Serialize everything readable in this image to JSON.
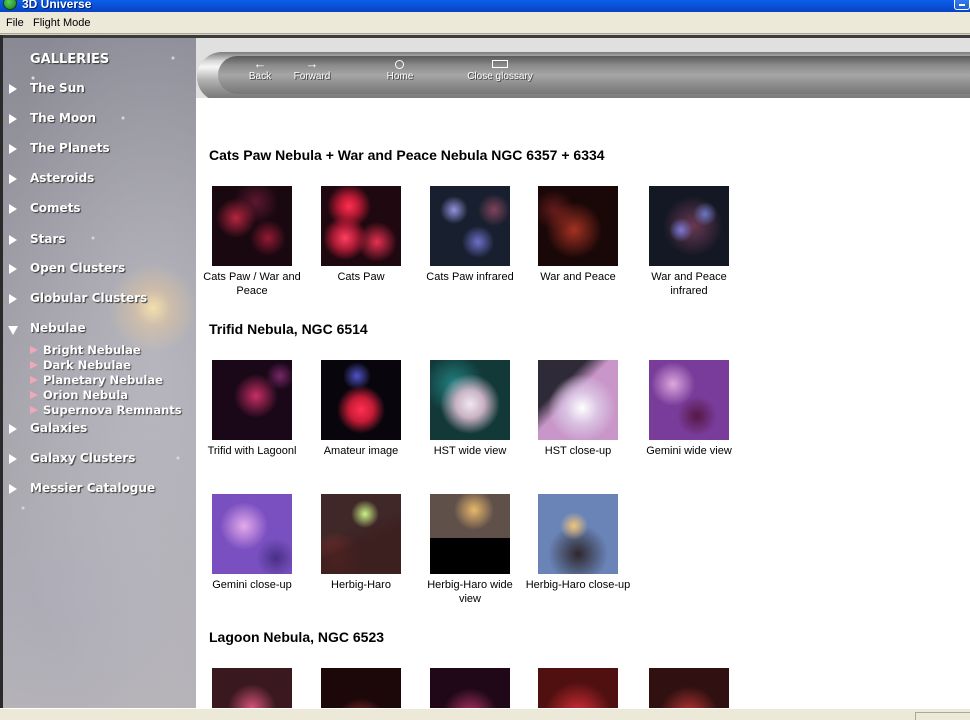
{
  "window": {
    "title": "3D Universe"
  },
  "menu": {
    "file": "File",
    "flight_mode": "Flight Mode"
  },
  "sidebar": {
    "heading": "GALLERIES",
    "items": [
      {
        "label": "The Sun",
        "expanded": false
      },
      {
        "label": "The Moon",
        "expanded": false
      },
      {
        "label": "The Planets",
        "expanded": false
      },
      {
        "label": "Asteroids",
        "expanded": false
      },
      {
        "label": "Comets",
        "expanded": false
      },
      {
        "label": "Stars",
        "expanded": false
      },
      {
        "label": "Open Clusters",
        "expanded": false
      },
      {
        "label": "Globular Clusters",
        "expanded": false
      },
      {
        "label": "Nebulae",
        "expanded": true
      },
      {
        "label": "Galaxies",
        "expanded": false
      },
      {
        "label": "Galaxy Clusters",
        "expanded": false
      },
      {
        "label": "Messier Catalogue",
        "expanded": false
      }
    ],
    "nebulae_sub": [
      {
        "label": "Bright Nebulae"
      },
      {
        "label": "Dark Nebulae"
      },
      {
        "label": "Planetary Nebulae"
      },
      {
        "label": "Orion Nebula"
      },
      {
        "label": "Supernova Remnants"
      }
    ]
  },
  "toolbar": {
    "back": "Back",
    "forward": "Forward",
    "home": "Home",
    "close_glossary": "Close glossary"
  },
  "content": {
    "sections": [
      {
        "title": "Cats Paw Nebula + War and Peace Nebula NGC 6357 + 6334",
        "rows": [
          [
            {
              "caption": "Cats Paw / War and Peace"
            },
            {
              "caption": "Cats Paw"
            },
            {
              "caption": "Cats Paw infrared"
            },
            {
              "caption": "War and Peace"
            },
            {
              "caption": "War and Peace infrared"
            }
          ]
        ]
      },
      {
        "title": "Trifid Nebula, NGC 6514",
        "rows": [
          [
            {
              "caption": "Trifid with Lagoonl"
            },
            {
              "caption": "Amateur image"
            },
            {
              "caption": "HST wide view"
            },
            {
              "caption": "HST close-up"
            },
            {
              "caption": "Gemini wide view"
            }
          ],
          [
            {
              "caption": "Gemini close-up"
            },
            {
              "caption": "Herbig-Haro"
            },
            {
              "caption": "Herbig-Haro wide view"
            },
            {
              "caption": "Herbig-Haro close-up"
            }
          ]
        ]
      },
      {
        "title": "Lagoon Nebula, NGC 6523",
        "rows": [
          [
            {
              "caption": ""
            },
            {
              "caption": ""
            },
            {
              "caption": ""
            },
            {
              "caption": ""
            },
            {
              "caption": ""
            }
          ]
        ]
      }
    ]
  },
  "colors": {
    "titlebar": "#0843c4",
    "submenu_arrow": "#f0a8b8",
    "content_bg": "#ffffff"
  }
}
